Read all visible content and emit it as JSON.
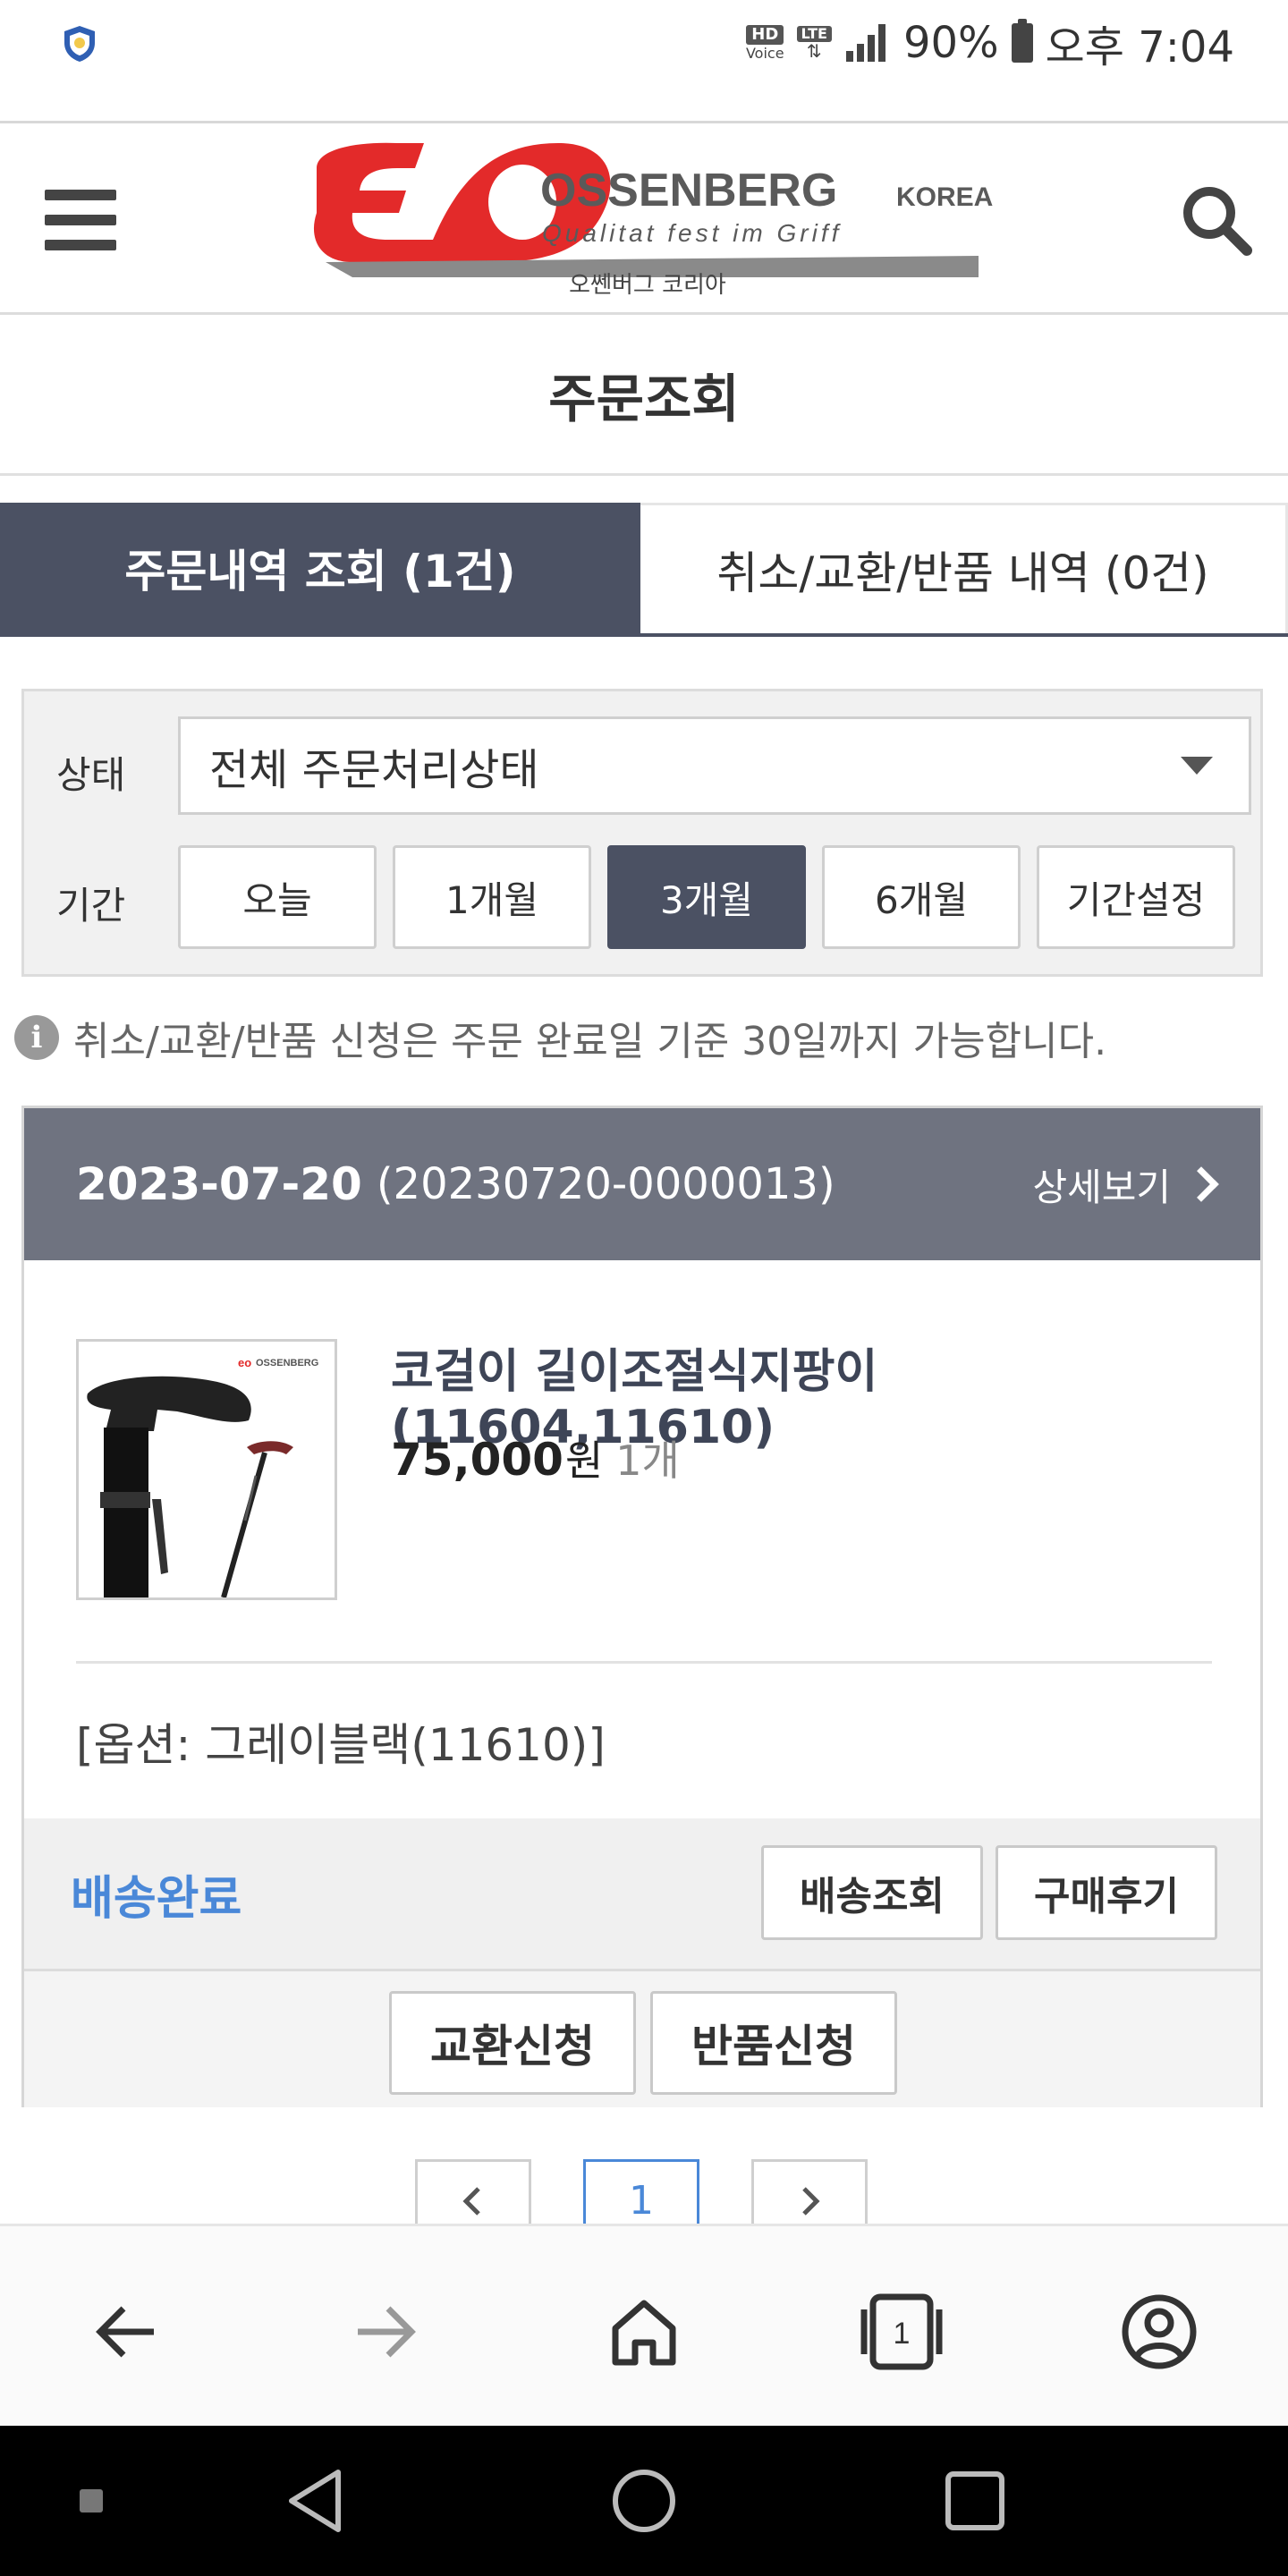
{
  "status_bar": {
    "hd_label": "HD",
    "voice_label": "Voice",
    "lte_label": "LTE",
    "battery": "90%",
    "time": "오후 7:04"
  },
  "header": {
    "brand": "OSSENBERG",
    "brand_suffix": "KOREA",
    "tagline": "Qualitat fest im Griff",
    "subtitle": "오쎈버그 코리아",
    "logo_colors": {
      "red": "#e32a2a",
      "gray": "#7a7a7a"
    }
  },
  "page": {
    "title": "주문조회"
  },
  "tabs": [
    {
      "label": "주문내역 조회 (1건)",
      "active": true
    },
    {
      "label": "취소/교환/반품 내역 (0건)",
      "active": false
    }
  ],
  "filter": {
    "status_label": "상태",
    "status_value": "전체 주문처리상태",
    "period_label": "기간",
    "periods": [
      {
        "label": "오늘",
        "active": false
      },
      {
        "label": "1개월",
        "active": false
      },
      {
        "label": "3개월",
        "active": true
      },
      {
        "label": "6개월",
        "active": false
      },
      {
        "label": "기간설정",
        "active": false
      }
    ]
  },
  "notice": "취소/교환/반품 신청은 주문 완료일 기준 30일까지 가능합니다.",
  "order": {
    "date": "2023-07-20",
    "number": "(20230720-0000013)",
    "detail_label": "상세보기",
    "product_name": "코걸이 길이조절식지팡이 (11604,11610)",
    "price": "75,000",
    "currency": "원",
    "quantity": "1개",
    "option": "[옵션: 그레이블랙(11610)]",
    "status": "배송완료",
    "track_button": "배송조회",
    "review_button": "구매후기",
    "exchange_button": "교환신청",
    "return_button": "반품신청",
    "thumb_brand": "OSSENBERG"
  },
  "pagination": {
    "prev": "‹",
    "current": "1",
    "next": "›"
  },
  "browser_nav": {
    "tab_count": "1"
  },
  "colors": {
    "accent_dark": "#4b5163",
    "header_gray": "#6f7380",
    "status_blue": "#4a88d8"
  }
}
